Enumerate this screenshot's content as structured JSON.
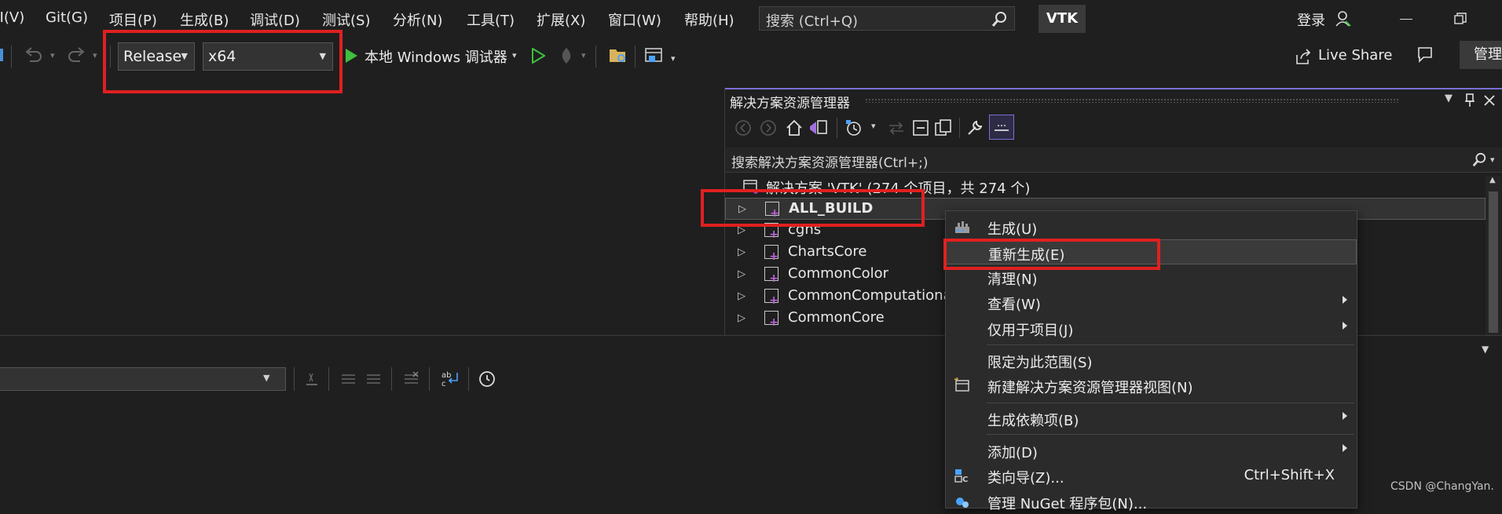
{
  "menu": {
    "items": [
      {
        "label": "Ⅱ(V)"
      },
      {
        "label": "Git(G)"
      },
      {
        "label": "项目(P)"
      },
      {
        "label": "生成(B)"
      },
      {
        "label": "调试(D)"
      },
      {
        "label": "测试(S)"
      },
      {
        "label": "分析(N)"
      },
      {
        "label": "工具(T)"
      },
      {
        "label": "扩展(X)"
      },
      {
        "label": "窗口(W)"
      },
      {
        "label": "帮助(H)"
      }
    ],
    "search_placeholder": "搜索 (Ctrl+Q)",
    "solution_badge": "VTK",
    "signin_label": "登录"
  },
  "toolbar": {
    "config_value": "Release",
    "platform_value": "x64",
    "debugger_label": "本地 Windows 调试器",
    "live_share_label": "Live Share",
    "admin_label": "管理"
  },
  "solution_explorer": {
    "title": "解决方案资源管理器",
    "search_placeholder": "搜索解决方案资源管理器(Ctrl+;)",
    "root_label": "解决方案 'VTK' (274 个项目，共 274 个)",
    "projects": [
      {
        "label": "ALL_BUILD",
        "bold": true
      },
      {
        "label": "cgns"
      },
      {
        "label": "ChartsCore"
      },
      {
        "label": "CommonColor"
      },
      {
        "label": "CommonComputationa"
      },
      {
        "label": "CommonCore"
      }
    ]
  },
  "context_menu": {
    "items": [
      {
        "label": "生成(U)"
      },
      {
        "label": "重新生成(E)"
      },
      {
        "label": "清理(N)"
      },
      {
        "label": "查看(W)"
      },
      {
        "label": "仅用于项目(J)"
      },
      {
        "label": "限定为此范围(S)"
      },
      {
        "label": "新建解决方案资源管理器视图(N)"
      },
      {
        "label": "生成依赖项(B)"
      },
      {
        "label": "添加(D)"
      },
      {
        "label": "类向导(Z)...",
        "shortcut": "Ctrl+Shift+X"
      },
      {
        "label": "管理 NuGet 程序包(N)..."
      }
    ]
  },
  "watermark": "CSDN @ChangYan.",
  "colors": {
    "highlight_red": "#e02020",
    "panel_accent": "#7a6fd8",
    "run_green": "#3fbf3f"
  }
}
